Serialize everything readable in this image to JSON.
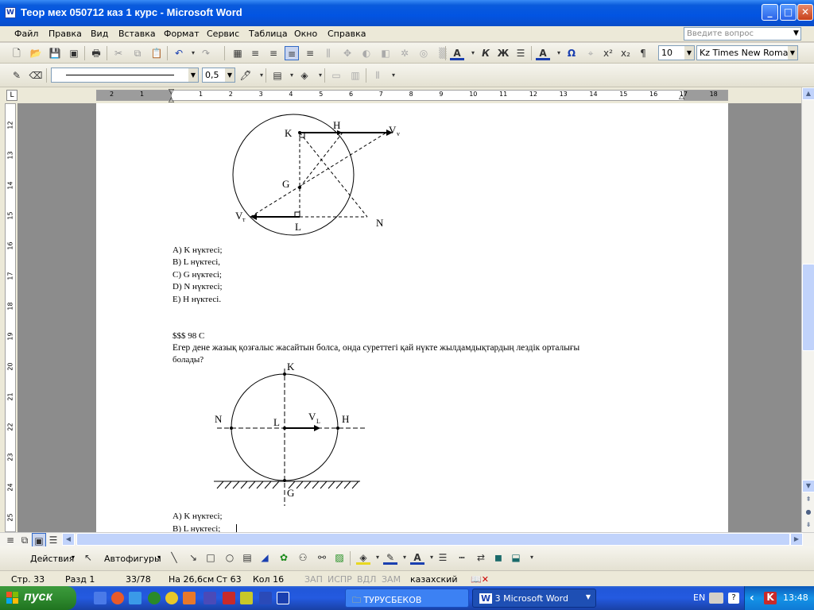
{
  "window": {
    "title": "Теор мех 050712 каз 1 курс - Microsoft Word",
    "icon_letter": "W"
  },
  "menu": {
    "items": [
      "Файл",
      "Правка",
      "Вид",
      "Вставка",
      "Формат",
      "Сервис",
      "Таблица",
      "Окно",
      "Справка"
    ],
    "ask_placeholder": "Введите вопрос"
  },
  "toolbar": {
    "font_size": "10",
    "font_name": "Kz Times New Roman",
    "line_weight": "0,5",
    "omega": "Ω",
    "pilcrow": "¶",
    "bold_k": "Ж",
    "italic_k": "К"
  },
  "ruler": {
    "h_left": [
      "2",
      "1"
    ],
    "h_right": [
      "1",
      "2",
      "3",
      "4",
      "5",
      "6",
      "7",
      "8",
      "9",
      "10",
      "11",
      "12",
      "13",
      "14",
      "15",
      "16",
      "17",
      "18"
    ],
    "v": [
      "12",
      "13",
      "14",
      "15",
      "16",
      "17",
      "18",
      "19",
      "20",
      "21",
      "22",
      "23",
      "24",
      "25"
    ]
  },
  "document": {
    "fig1_labels": {
      "K": "K",
      "H": "H",
      "Vv": "V",
      "Vv_sub": "v",
      "G": "G",
      "Vt": "V",
      "Vt_sub": "т",
      "L": "L",
      "N": "N"
    },
    "answers1": [
      "A)   K нүктесі;",
      "B)   L нүктесі,",
      "C)   G нүктесі;",
      "D)   N нүктесі;",
      "E)   H нүктесі."
    ],
    "question_id": "$$$ 98 C",
    "question_line1": "Егер  дене  жазық  қозғалыс  жасайтын  болса,  онда  суреттегі  қай  нүкте  жылдамдықтардың  лездік  орталығы",
    "question_line2": "болады?",
    "fig2_labels": {
      "K": "K",
      "N": "N",
      "L": "L",
      "VL": "V",
      "VL_sub": "L",
      "H": "H",
      "G": "G"
    },
    "answers2": [
      "A)   K нүктесі;",
      "B)   L нүктесі;"
    ]
  },
  "drawing": {
    "actions": "Действия",
    "autoshapes": "Автофигуры"
  },
  "status": {
    "page": "Стр.  33",
    "section": "Разд  1",
    "pages": "33/78",
    "pos": "На  26,6см",
    "line": "Ст  63",
    "col": "Кол  16",
    "rec": "ЗАП",
    "trk": "ИСПР",
    "ext": "ВДЛ",
    "ovr": "ЗАМ",
    "lang": "казахский"
  },
  "taskbar": {
    "start": "пуск",
    "folder_task": "ТУРУСБЕКОВ",
    "word_task": "3 Microsoft Word",
    "lang": "EN",
    "clock": "13:48"
  }
}
